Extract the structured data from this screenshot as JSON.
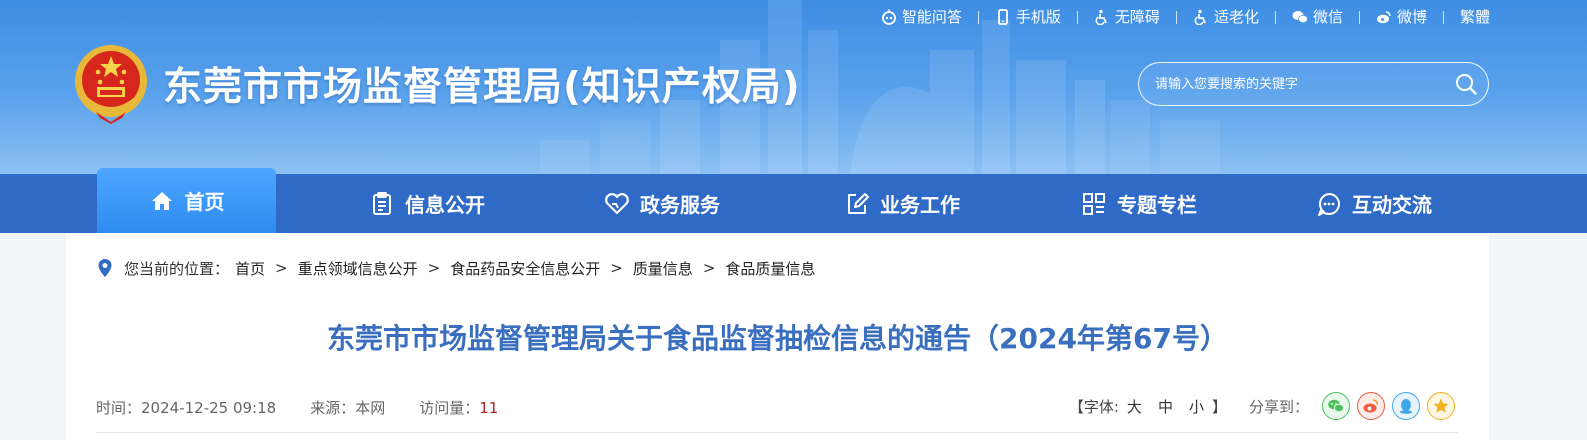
{
  "topbar": {
    "items": [
      {
        "label": "智能问答",
        "icon": "robot-icon"
      },
      {
        "label": "手机版",
        "icon": "mobile-icon"
      },
      {
        "label": "无障碍",
        "icon": "accessibility-icon"
      },
      {
        "label": "适老化",
        "icon": "elderly-icon"
      },
      {
        "label": "微信",
        "icon": "wechat-icon"
      },
      {
        "label": "微博",
        "icon": "weibo-icon"
      },
      {
        "label": "繁體",
        "icon": ""
      }
    ]
  },
  "header": {
    "site_title": "东莞市市场监督管理局(知识产权局)",
    "logo": "national-emblem"
  },
  "search": {
    "placeholder": "请输入您要搜索的关键字",
    "icon": "search-icon"
  },
  "nav": {
    "items": [
      {
        "label": "首页",
        "icon": "home-icon",
        "active": true
      },
      {
        "label": "信息公开",
        "icon": "clipboard-icon",
        "active": false
      },
      {
        "label": "政务服务",
        "icon": "heart-icon",
        "active": false
      },
      {
        "label": "业务工作",
        "icon": "edit-icon",
        "active": false
      },
      {
        "label": "专题专栏",
        "icon": "grid-icon",
        "active": false
      },
      {
        "label": "互动交流",
        "icon": "chat-icon",
        "active": false
      }
    ]
  },
  "breadcrumb": {
    "prefix": "您当前的位置：",
    "items": [
      "首页",
      "重点领域信息公开",
      "食品药品安全信息公开",
      "质量信息",
      "食品质量信息"
    ],
    "separator": ">"
  },
  "article": {
    "title": "东莞市市场监督管理局关于食品监督抽检信息的通告（2024年第67号）",
    "time_label": "时间：",
    "time": "2024-12-25 09:18",
    "source_label": "来源：",
    "source": "本网",
    "visits_label": "访问量：",
    "visits": "11"
  },
  "tools": {
    "font_open": "【字体:",
    "font_large": "大",
    "font_medium": "中",
    "font_small": "小",
    "font_close": "】",
    "share_label": "分享到：",
    "share_targets": [
      "wechat",
      "weibo",
      "qq",
      "qzone"
    ]
  },
  "colors": {
    "nav_bg": "#2f6ac6",
    "nav_active": "#2e8cf0",
    "title_blue": "#3a6fc0",
    "visits_red": "#b5251d"
  }
}
